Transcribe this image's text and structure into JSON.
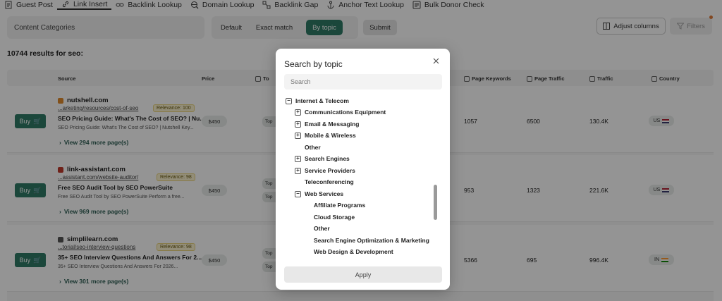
{
  "nav": {
    "items": [
      {
        "label": "Guest Post",
        "icon": "document-icon"
      },
      {
        "label": "Link Insert",
        "icon": "link-icon",
        "active": true
      },
      {
        "label": "Backlink Lookup",
        "icon": "chain-icon"
      },
      {
        "label": "Domain Lookup",
        "icon": "globe-search-icon"
      },
      {
        "label": "Backlink Gap",
        "icon": "gap-icon"
      },
      {
        "label": "Anchor Text Lookup",
        "icon": "anchor-icon"
      },
      {
        "label": "Bulk Donor Check",
        "icon": "list-check-icon"
      }
    ]
  },
  "toolbar": {
    "content_categories": "Content Categories",
    "modes": [
      "Default",
      "Exact match",
      "By topic"
    ],
    "submit": "Submit",
    "adjust_columns": "Adjust columns",
    "filters": "Filters"
  },
  "results_label": "10744 results for seo:",
  "table": {
    "headers": {
      "source": "Source",
      "price": "Price",
      "topic": "To",
      "page_keywords": "Page Keywords",
      "page_traffic": "Page Traffic",
      "traffic": "Traffic",
      "country": "Country"
    },
    "buy_label": "Buy",
    "rows": [
      {
        "domain": "nutshell.com",
        "url": "...arketing/resources/cost-of-seo",
        "relevance": "Relevance: 100",
        "title": "SEO Pricing Guide: What's The Cost of SEO? | Nu...",
        "desc": "SEO Pricing Guide: What's The Cost of SEO? | Nutshell Key...",
        "more": "View 294 more page(s)",
        "price": "$450",
        "topic": "Top",
        "page_keywords": "1057",
        "page_traffic": "6500",
        "traffic": "130.4K",
        "country": "US"
      },
      {
        "domain": "link-assistant.com",
        "url": "...assistant.com/website-auditor/",
        "relevance": "Relevance: 98",
        "title": "Free SEO Audit Tool by SEO PowerSuite",
        "desc": "Free SEO Audit Tool by SEO PowerSuite Perform a free...",
        "more": "View 969 more page(s)",
        "price": "$450",
        "topic": "Top",
        "page_keywords": "953",
        "page_traffic": "1323",
        "traffic": "221.6K",
        "country": "US"
      },
      {
        "domain": "simplilearn.com",
        "url": "...torial/seo-interview-questions",
        "relevance": "Relevance: 98",
        "title": "35+ SEO Interview Questions And Answers For 2...",
        "desc": "35+ SEO Interview Questions And Answers For 2026...",
        "more": "View 301 more page(s)",
        "price": "$450",
        "topic": "Top",
        "page_keywords": "5366",
        "page_traffic": "695",
        "traffic": "996.4K",
        "country": "IN"
      }
    ]
  },
  "modal": {
    "title": "Search by topic",
    "search_placeholder": "Search",
    "tree": [
      {
        "label": "Internet & Telecom",
        "level": 0,
        "box": "minus"
      },
      {
        "label": "Communications Equipment",
        "level": 1,
        "box": "plus"
      },
      {
        "label": "Email & Messaging",
        "level": 1,
        "box": "plus"
      },
      {
        "label": "Mobile & Wireless",
        "level": 1,
        "box": "plus"
      },
      {
        "label": "Other",
        "level": 1,
        "box": "none"
      },
      {
        "label": "Search Engines",
        "level": 1,
        "box": "plus"
      },
      {
        "label": "Service Providers",
        "level": 1,
        "box": "plus"
      },
      {
        "label": "Teleconferencing",
        "level": 1,
        "box": "none"
      },
      {
        "label": "Web Services",
        "level": 1,
        "box": "minus"
      },
      {
        "label": "Affiliate Programs",
        "level": 2,
        "box": "none"
      },
      {
        "label": "Cloud Storage",
        "level": 2,
        "box": "none"
      },
      {
        "label": "Other",
        "level": 2,
        "box": "none"
      },
      {
        "label": "Search Engine Optimization & Marketing",
        "level": 2,
        "box": "none"
      },
      {
        "label": "Web Design & Development",
        "level": 2,
        "box": "none"
      }
    ],
    "apply": "Apply"
  },
  "colors": {
    "accent": "#2f7a66",
    "overlay": "rgba(0,0,0,0.42)"
  }
}
